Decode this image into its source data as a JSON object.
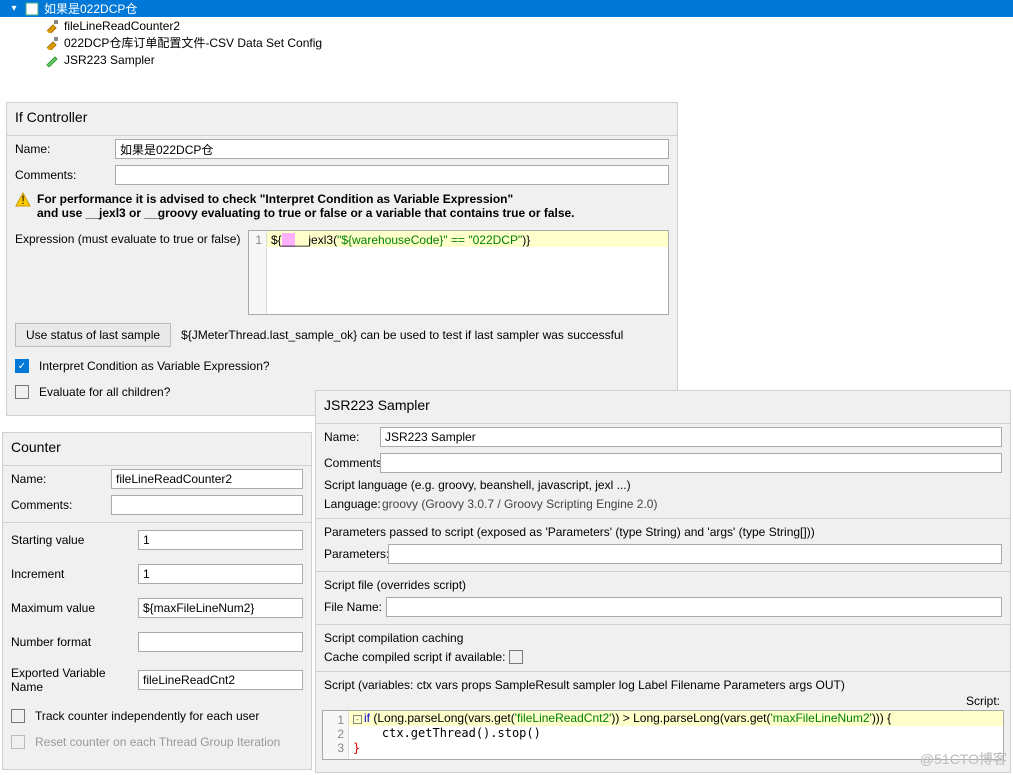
{
  "tree": {
    "items": [
      {
        "indent": 8,
        "chevron": "▾",
        "icon": "if-icon",
        "label": "如果是022DCP仓",
        "selected": true
      },
      {
        "indent": 40,
        "chevron": "",
        "icon": "wrench-icon",
        "label": "fileLineReadCounter2"
      },
      {
        "indent": 40,
        "chevron": "",
        "icon": "wrench-icon",
        "label": "022DCP仓库订单配置文件-CSV Data Set Config"
      },
      {
        "indent": 40,
        "chevron": "",
        "icon": "pencil-icon",
        "label": "JSR223 Sampler"
      },
      {
        "indent": 40,
        "chevron": "",
        "icon": "blank-icon",
        "label": ""
      }
    ]
  },
  "ifc": {
    "title": "If Controller",
    "name_label": "Name:",
    "name_value": "如果是022DCP仓",
    "comments_label": "Comments:",
    "comments_value": "",
    "warn1": "For performance it is advised to check \"Interpret Condition as Variable Expression\"",
    "warn2": "and use __jexl3 or __groovy evaluating to true or false or a variable that contains true or false.",
    "expr_label": "Expression (must evaluate to true or false)",
    "expr_prefix": "${",
    "expr_func": "__jexl3(",
    "expr_arg": "\"${warehouseCode}\" == \"022DCP\"",
    "expr_suffix": ")}",
    "last_btn": "Use status of last sample",
    "last_hint": "${JMeterThread.last_sample_ok} can be used to test if last sampler was successful",
    "interpret": "Interpret Condition as Variable Expression?",
    "eval_all": "Evaluate for all children?"
  },
  "counter": {
    "title": "Counter",
    "name_label": "Name:",
    "name_value": "fileLineReadCounter2",
    "comments_label": "Comments:",
    "comments_value": "",
    "start_label": "Starting value",
    "start_value": "1",
    "inc_label": "Increment",
    "inc_value": "1",
    "max_label": "Maximum value",
    "max_value": "${maxFileLineNum2}",
    "numfmt_label": "Number format",
    "numfmt_value": "",
    "export_label": "Exported Variable Name",
    "export_value": "fileLineReadCnt2",
    "track": "Track counter independently for each user",
    "reset": "Reset counter on each Thread Group Iteration"
  },
  "jsr": {
    "title": "JSR223 Sampler",
    "name_label": "Name:",
    "name_value": "JSR223 Sampler",
    "comments_label": "Comments:",
    "comments_value": "",
    "lang_hdr": "Script language (e.g. groovy, beanshell, javascript, jexl ...)",
    "lang_label": "Language:",
    "lang_value": "groovy     (Groovy 3.0.7 / Groovy Scripting Engine 2.0)",
    "params_hdr": "Parameters passed to script (exposed as 'Parameters' (type String) and 'args' (type String[]))",
    "params_label": "Parameters:",
    "params_value": "",
    "file_hdr": "Script file (overrides script)",
    "file_label": "File Name:",
    "file_value": "",
    "cache_hdr": "Script compilation caching",
    "cache_label": "Cache compiled script if available:",
    "script_hdr": "Script (variables: ctx vars props SampleResult sampler log Label Filename Parameters args OUT)",
    "script_col": "Script:",
    "code": {
      "l1_if": "if ",
      "l1_p1": "(Long.parseLong(vars.get(",
      "l1_s1": "'fileLineReadCnt2'",
      "l1_p2": ")) > Long.parseLong(vars.get(",
      "l1_s2": "'maxFileLineNum2'",
      "l1_p3": "))) {",
      "l2": "    ctx.getThread().stop()",
      "l3": "}"
    }
  },
  "watermark": "@51CTO博客"
}
